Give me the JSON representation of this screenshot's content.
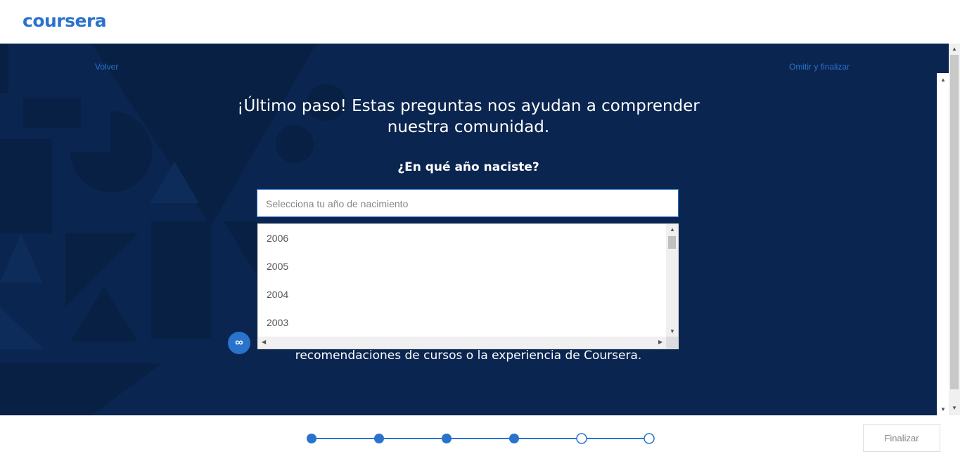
{
  "header": {
    "logo_text": "coursera"
  },
  "nav": {
    "back_label": "Volver",
    "skip_label": "Omitir y finalizar"
  },
  "main": {
    "title": "¡Último paso! Estas preguntas nos ayudan a comprender nuestra comunidad.",
    "question": "¿En qué año naciste?",
    "select_placeholder": "Selecciona tu año de nacimiento",
    "years": [
      "2006",
      "2005",
      "2004",
      "2003"
    ],
    "behind_text": "recomendaciones de cursos o la experiencia de Coursera."
  },
  "footer": {
    "progress": {
      "total_steps": 6,
      "completed_steps": 4
    },
    "finish_label": "Finalizar"
  },
  "colors": {
    "brand": "#2a73cc",
    "background": "#0a2550"
  }
}
